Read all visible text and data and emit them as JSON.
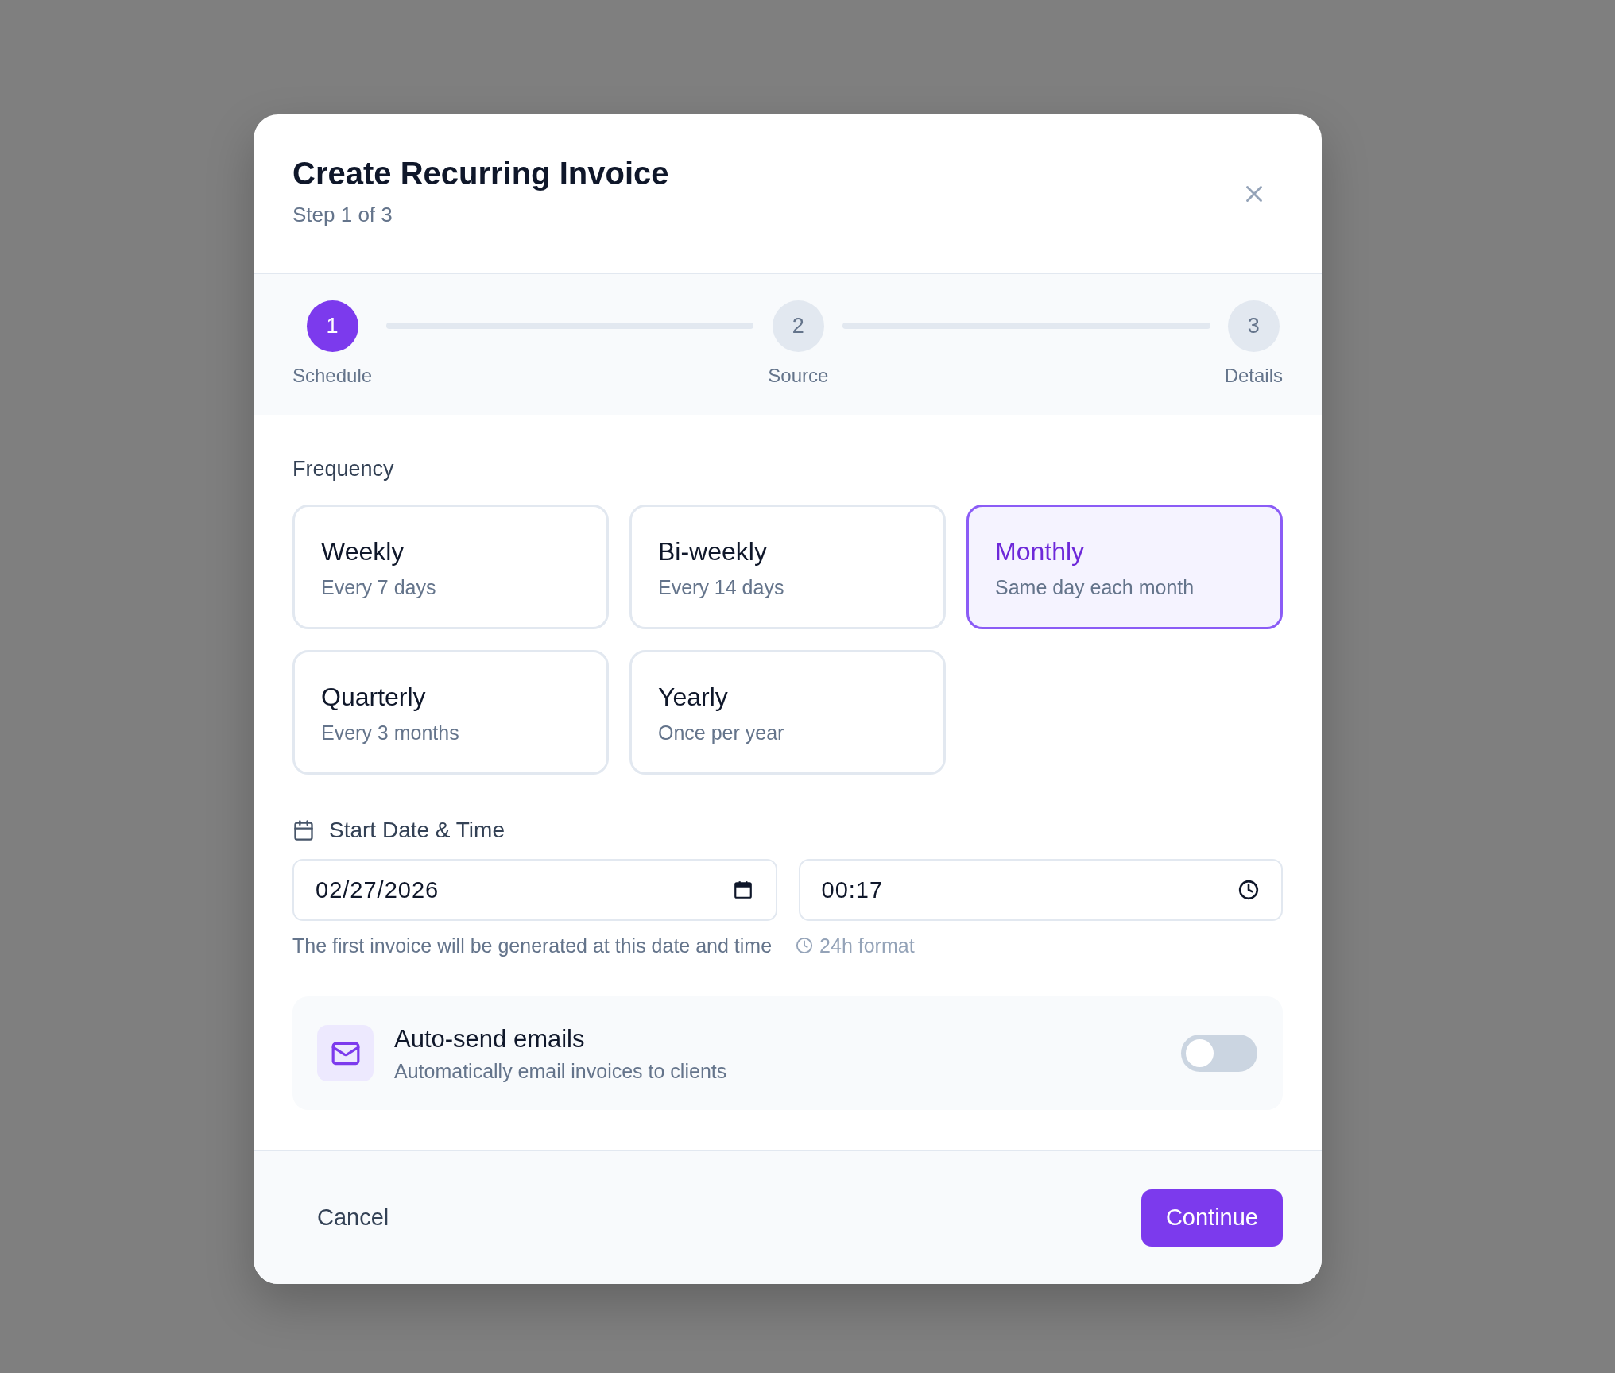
{
  "dialog": {
    "title": "Create Recurring Invoice",
    "subtitle": "Step 1 of 3"
  },
  "stepper": {
    "steps": [
      {
        "number": "1",
        "label": "Schedule",
        "selected": true
      },
      {
        "number": "2",
        "label": "Source",
        "selected": false
      },
      {
        "number": "3",
        "label": "Details",
        "selected": false
      }
    ]
  },
  "frequency": {
    "label": "Frequency",
    "options": [
      {
        "title": "Weekly",
        "description": "Every 7 days",
        "selected": false
      },
      {
        "title": "Bi-weekly",
        "description": "Every 14 days",
        "selected": false
      },
      {
        "title": "Monthly",
        "description": "Same day each month",
        "selected": true
      },
      {
        "title": "Quarterly",
        "description": "Every 3 months",
        "selected": false
      },
      {
        "title": "Yearly",
        "description": "Once per year",
        "selected": false
      }
    ]
  },
  "start": {
    "label": "Start Date & Time",
    "date": {
      "value": "02/27/2026"
    },
    "time": {
      "value": "00:17"
    },
    "hint": "The first invoice will be generated at this date and time",
    "format_note": "24h format"
  },
  "auto_send": {
    "title": "Auto-send emails",
    "description": "Automatically email invoices to clients",
    "on": false
  },
  "footer": {
    "buttons": [
      {
        "label": "Cancel",
        "kind": "ghost"
      },
      {
        "label": "Continue",
        "kind": "primary"
      }
    ]
  }
}
